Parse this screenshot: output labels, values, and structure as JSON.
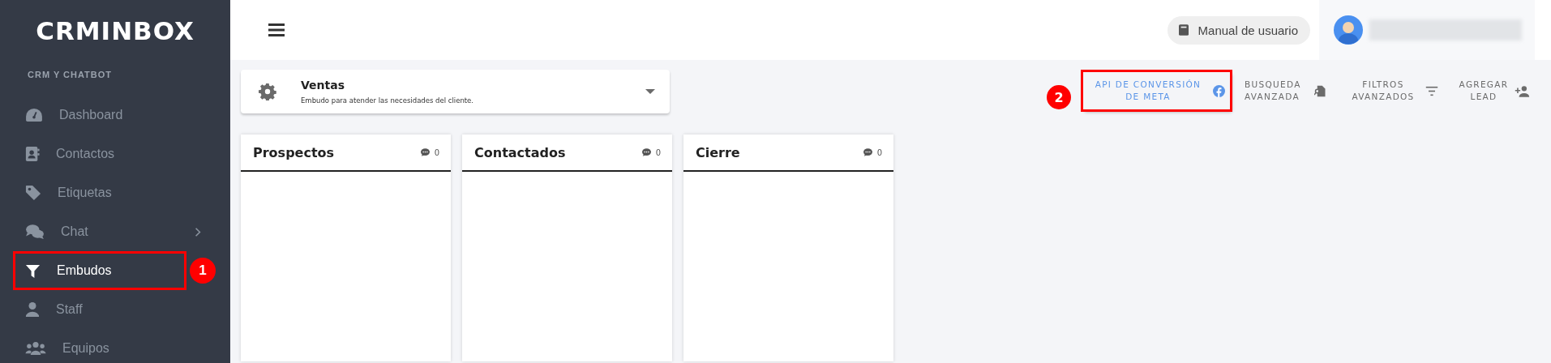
{
  "sidebar": {
    "logo": "CRMINBOX",
    "section_title": "CRM Y CHATBOT",
    "items": [
      {
        "label": "Dashboard",
        "selected": false,
        "kind": "link"
      },
      {
        "label": "Contactos",
        "selected": false,
        "kind": "link"
      },
      {
        "label": "Etiquetas",
        "selected": false,
        "kind": "link"
      },
      {
        "label": "Chat",
        "selected": false,
        "kind": "submenu"
      },
      {
        "label": "Embudos",
        "selected": true,
        "kind": "link",
        "annotation": "1"
      },
      {
        "label": "Staff",
        "selected": false,
        "kind": "link"
      },
      {
        "label": "Equipos",
        "selected": false,
        "kind": "link"
      }
    ]
  },
  "topbar": {
    "manual_button": "Manual de usuario"
  },
  "funnel": {
    "name": "Ventas",
    "description": "Embudo para atender las necesidades del cliente."
  },
  "toolbar": [
    {
      "label": "API DE CONVERSIÓN DE META",
      "kind": "link",
      "annotation": "2"
    },
    {
      "label": "BUSQUEDA AVANZADA",
      "kind": "action"
    },
    {
      "label": "FILTROS AVANZADOS",
      "kind": "action"
    },
    {
      "label": "AGREGAR LEAD",
      "kind": "action"
    }
  ],
  "columns": [
    {
      "title": "Prospectos",
      "count": "0"
    },
    {
      "title": "Contactados",
      "count": "0"
    },
    {
      "title": "Cierre",
      "count": "0"
    }
  ]
}
